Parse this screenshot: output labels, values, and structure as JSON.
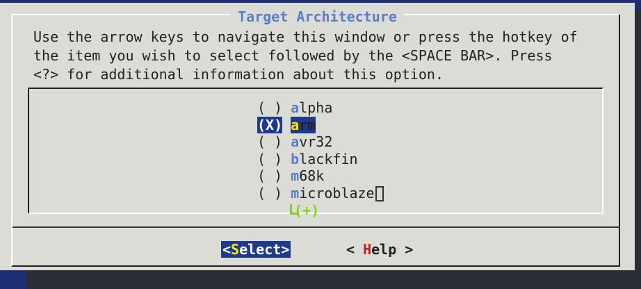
{
  "dialog": {
    "title": "Target Architecture",
    "instructions": [
      "Use the arrow keys to navigate this window or press the hotkey of",
      "the item you wish to select followed by the <SPACE BAR>. Press",
      "<?> for additional information about this option."
    ]
  },
  "options": [
    {
      "radio": "( )",
      "hotkey": "a",
      "rest": "lpha",
      "selected": false
    },
    {
      "radio": "(X)",
      "hotkey": "a",
      "rest": "rm",
      "selected": true
    },
    {
      "radio": "( )",
      "hotkey": "a",
      "rest": "vr32",
      "selected": false
    },
    {
      "radio": "( )",
      "hotkey": "b",
      "rest": "lackfin",
      "selected": false
    },
    {
      "radio": "( )",
      "hotkey": "m",
      "rest": "68k",
      "selected": false
    },
    {
      "radio": "( )",
      "hotkey": "m",
      "rest": "icroblaze",
      "selected": false
    }
  ],
  "more_indicator": "(+)",
  "buttons": {
    "select": {
      "pre": "<",
      "hotkey": "S",
      "post": "elect>"
    },
    "help": {
      "pre": "< ",
      "hotkey": "H",
      "post": "elp >"
    }
  }
}
